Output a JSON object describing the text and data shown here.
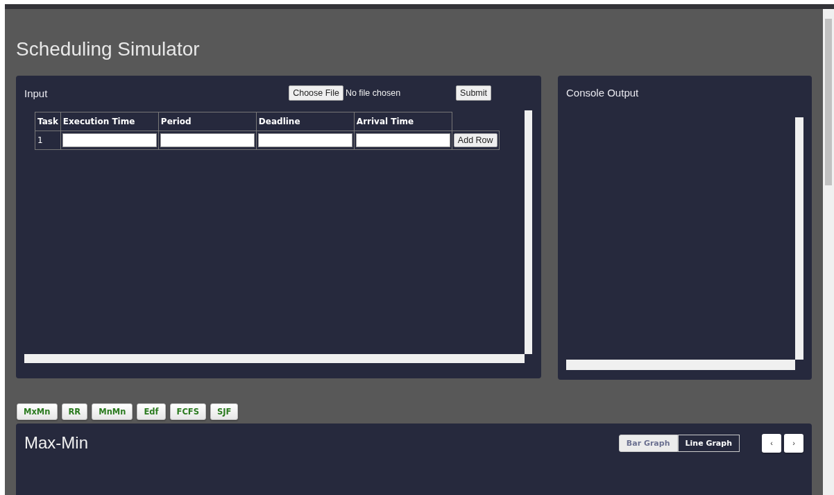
{
  "page": {
    "title": "Scheduling Simulator"
  },
  "input_panel": {
    "title": "Input",
    "file_button": "Choose File",
    "file_status": "No file chosen",
    "submit_button": "Submit",
    "table": {
      "columns": [
        "Task",
        "Execution Time",
        "Period",
        "Deadline",
        "Arrival Time"
      ],
      "rows": [
        {
          "task": "1"
        }
      ],
      "add_row_button": "Add Row"
    }
  },
  "console_panel": {
    "title": "Console Output"
  },
  "algorithm_buttons": [
    "MxMn",
    "RR",
    "MnMn",
    "Edf",
    "FCFS",
    "SJF"
  ],
  "chart_panel": {
    "title": "Max-Min",
    "graph_tabs": [
      {
        "label": "Bar Graph",
        "selected": false
      },
      {
        "label": "Line Graph",
        "selected": true
      }
    ],
    "nav_buttons": [
      "‹",
      "›"
    ]
  }
}
